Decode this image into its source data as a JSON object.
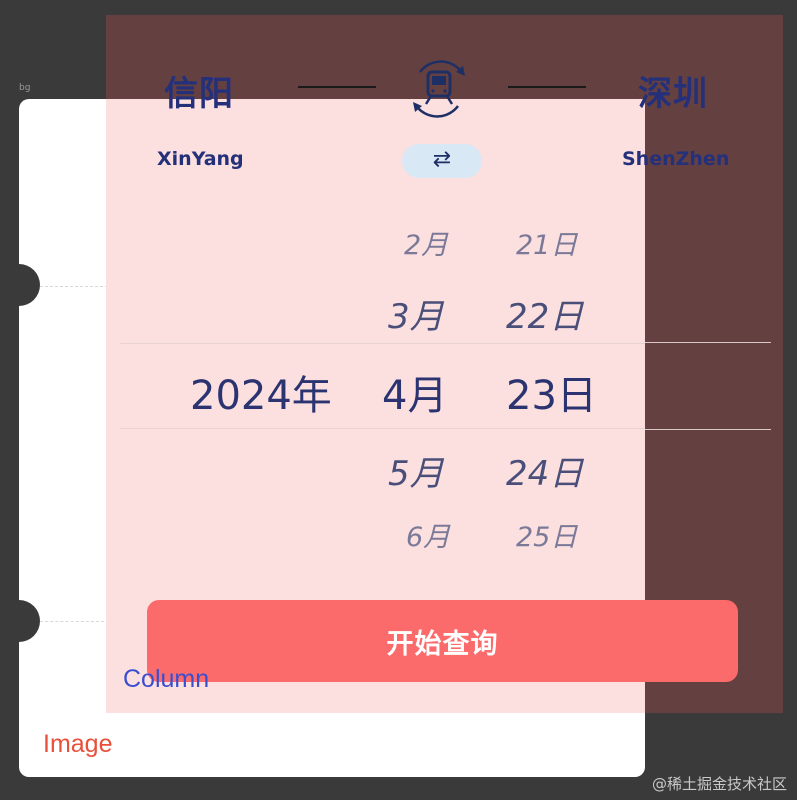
{
  "labels": {
    "bg": "bg",
    "column": "Column",
    "image": "Image"
  },
  "route": {
    "from": {
      "name": "信阳",
      "pinyin": "XinYang"
    },
    "to": {
      "name": "深圳",
      "pinyin": "ShenZhen"
    },
    "swap_icon": "⇄",
    "train_icon": "train-icon"
  },
  "picker": {
    "year": "2024年",
    "months": [
      "2月",
      "3月",
      "4月",
      "5月",
      "6月"
    ],
    "days": [
      "21日",
      "22日",
      "23日",
      "24日",
      "25日"
    ]
  },
  "button": {
    "label": "开始查询"
  },
  "watermark": "@稀土掘金技术社区",
  "colors": {
    "accent": "#fc6b6b",
    "city": "#25307a",
    "swap_bg": "#d9e8f5"
  }
}
